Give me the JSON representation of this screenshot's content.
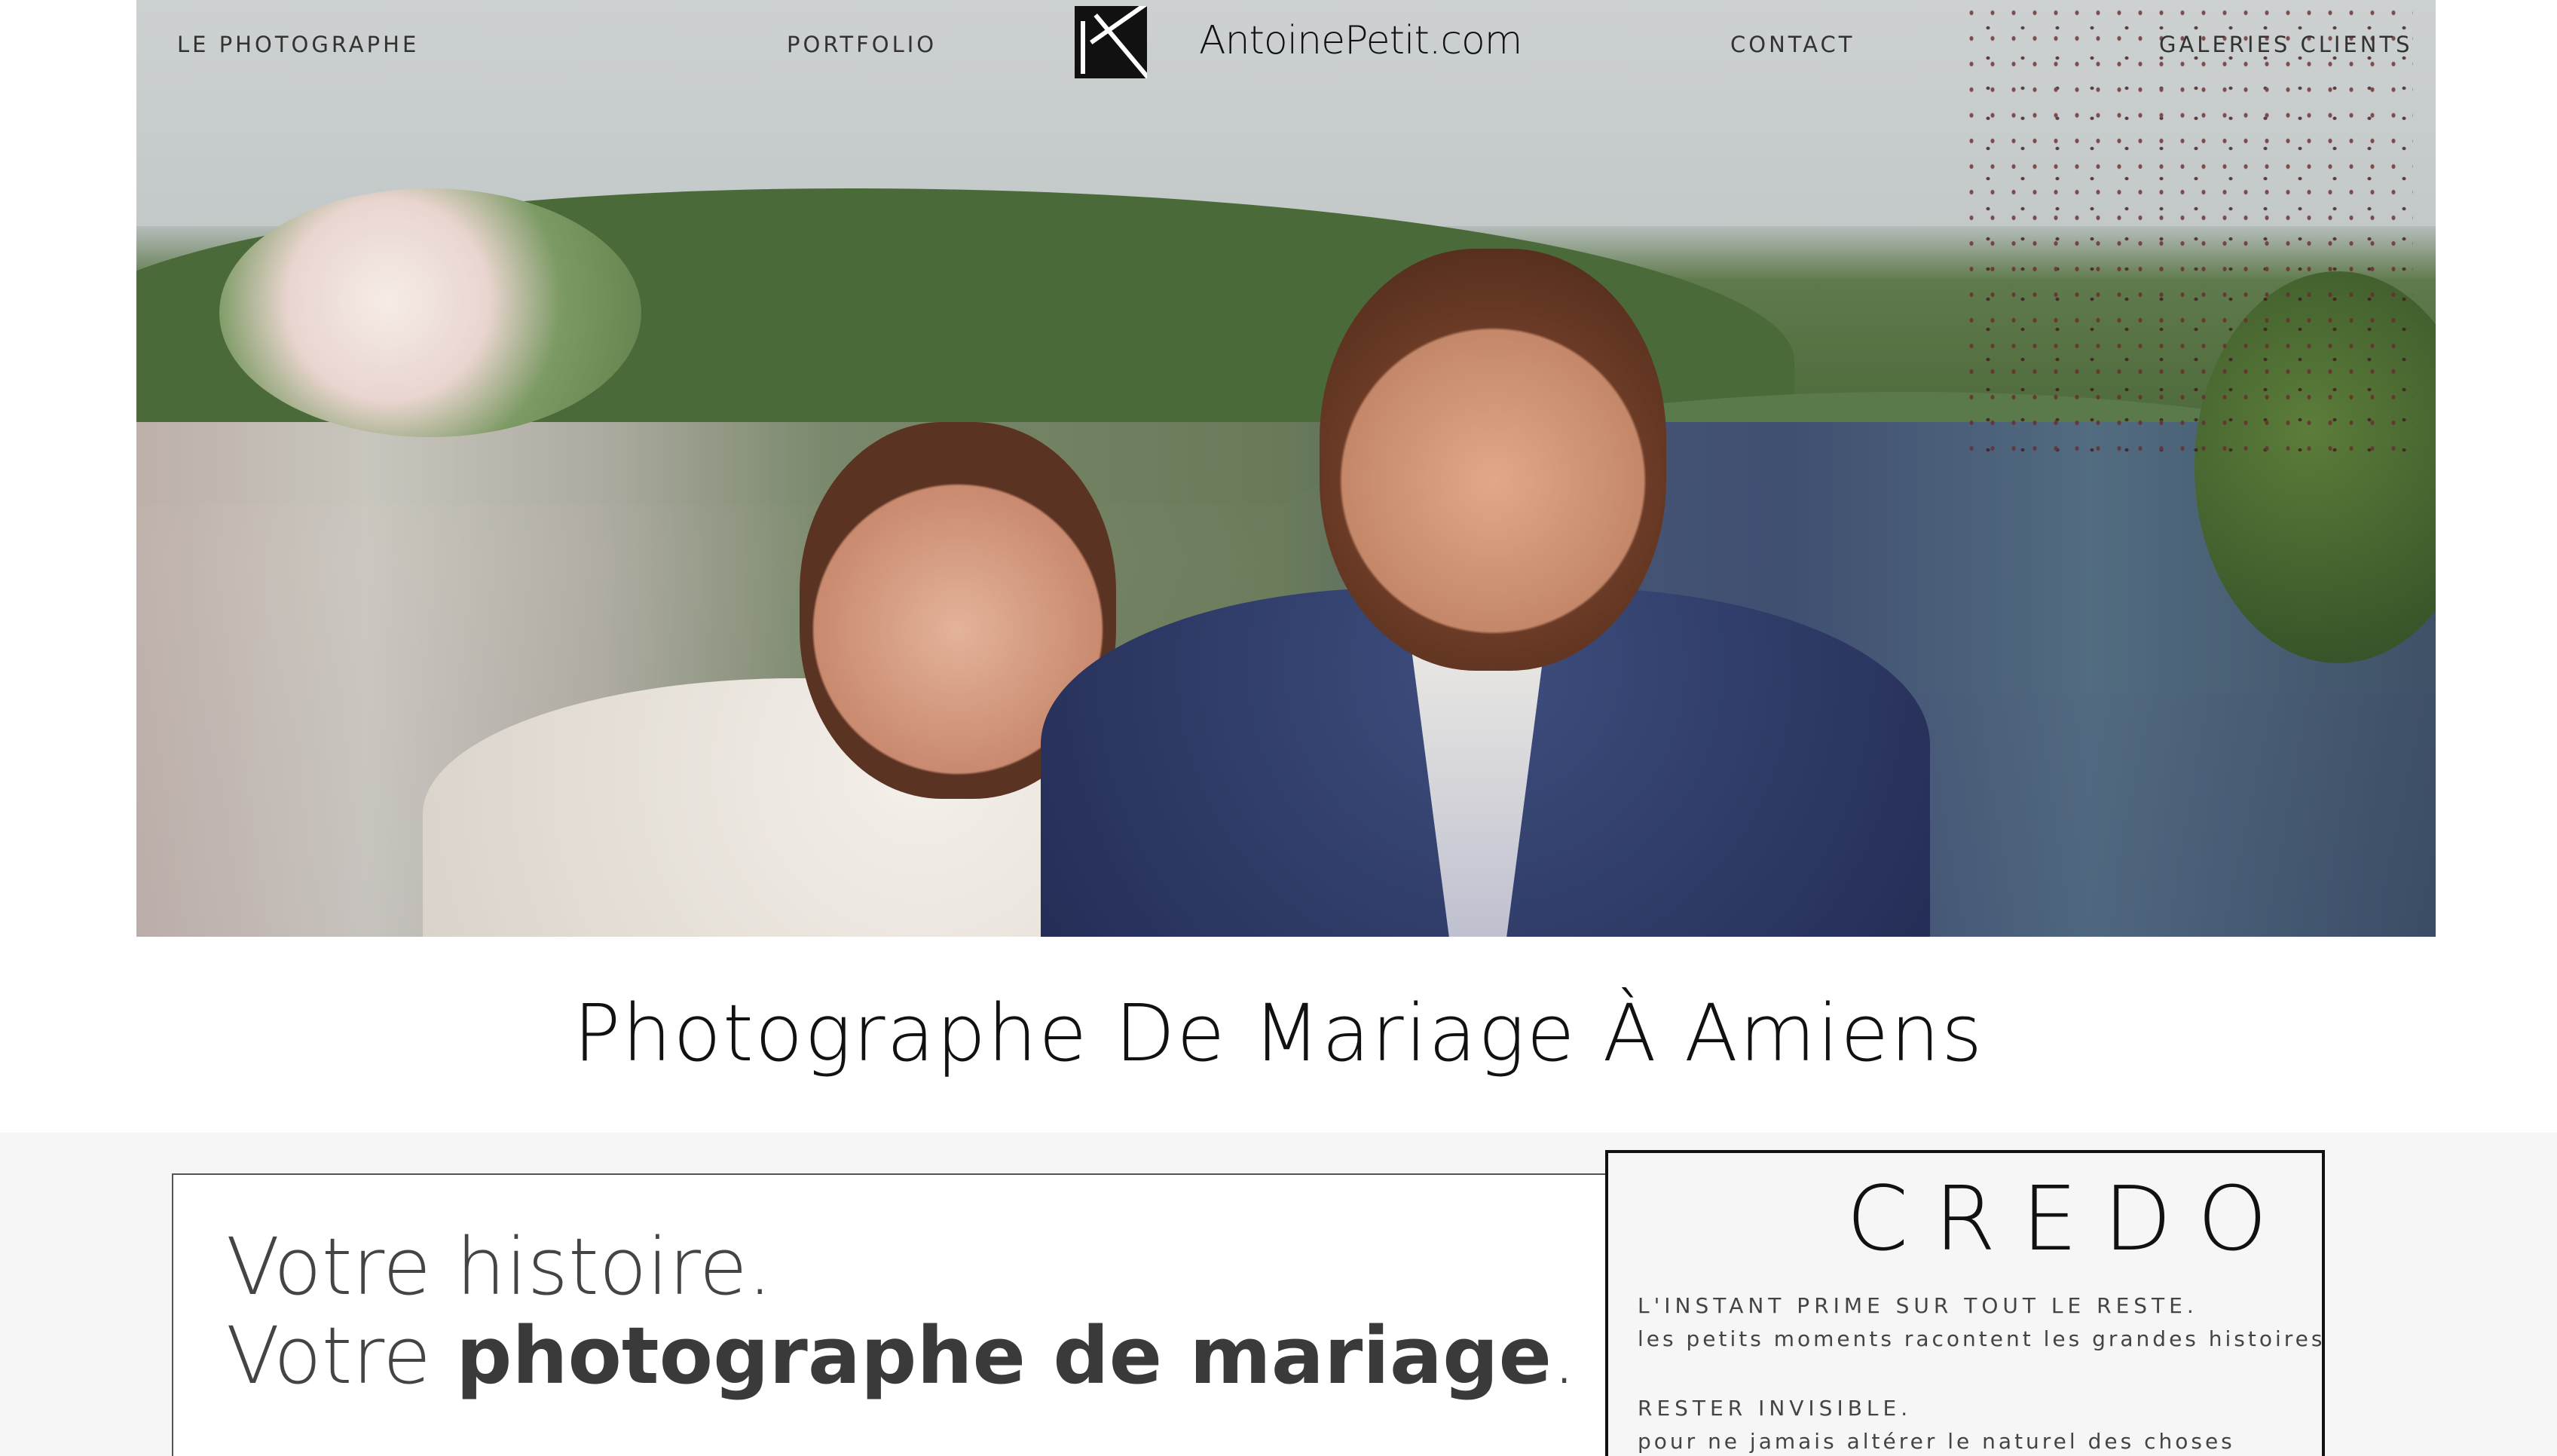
{
  "nav": {
    "left_links": [
      "LE PHOTOGRAPHE",
      "PORTFOLIO"
    ],
    "right_links": [
      "CONTACT",
      "GALERIES CLIENTS"
    ],
    "logo_text": "AntoinePetit.com"
  },
  "hero": {
    "image_subject": "wedding couple walking through confetti"
  },
  "page_title": "Photographe De Mariage À Amiens",
  "story": {
    "line1": "Votre histoire.",
    "line2_prefix": "Votre ",
    "line2_bold": "photographe de mariage",
    "line2_suffix": "."
  },
  "credo": {
    "title": "CREDO",
    "items": [
      {
        "heading": "L'INSTANT PRIME SUR TOUT LE RESTE.",
        "text": "les petits moments racontent les grandes histoires"
      },
      {
        "heading": "RESTER INVISIBLE.",
        "text": "pour ne jamais altérer le naturel des choses"
      }
    ]
  },
  "colors": {
    "text_dark": "#111111",
    "section_bg": "#f6f6f6",
    "card_border": "#111111"
  }
}
